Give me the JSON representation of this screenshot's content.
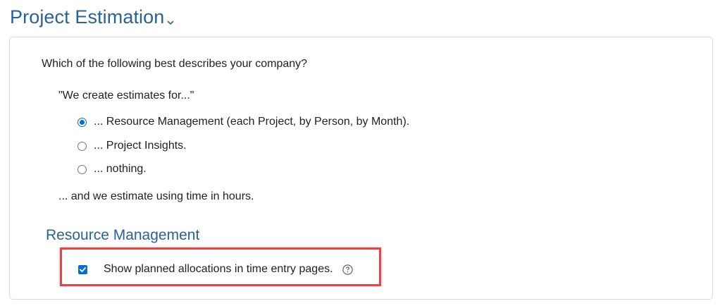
{
  "header": {
    "title": "Project Estimation",
    "toggle_icon": "chevron-down-icon"
  },
  "estimation": {
    "question": "Which of the following best describes your company?",
    "quote": "\"We create estimates for...\"",
    "options": [
      {
        "label": "... Resource Management (each Project, by Person, by Month).",
        "selected": true
      },
      {
        "label": "... Project Insights.",
        "selected": false
      },
      {
        "label": "... nothing.",
        "selected": false
      }
    ],
    "unit_line": "... and we estimate using time in hours."
  },
  "resource_management": {
    "title": "Resource Management",
    "show_allocations": {
      "label": "Show planned allocations in time entry pages.",
      "checked": true,
      "help_icon": "question-circle-icon"
    }
  },
  "colors": {
    "accent": "#2b6296",
    "control": "#0a6ed1",
    "highlight": "#e0474c",
    "panel_border": "#dcdcdc"
  }
}
